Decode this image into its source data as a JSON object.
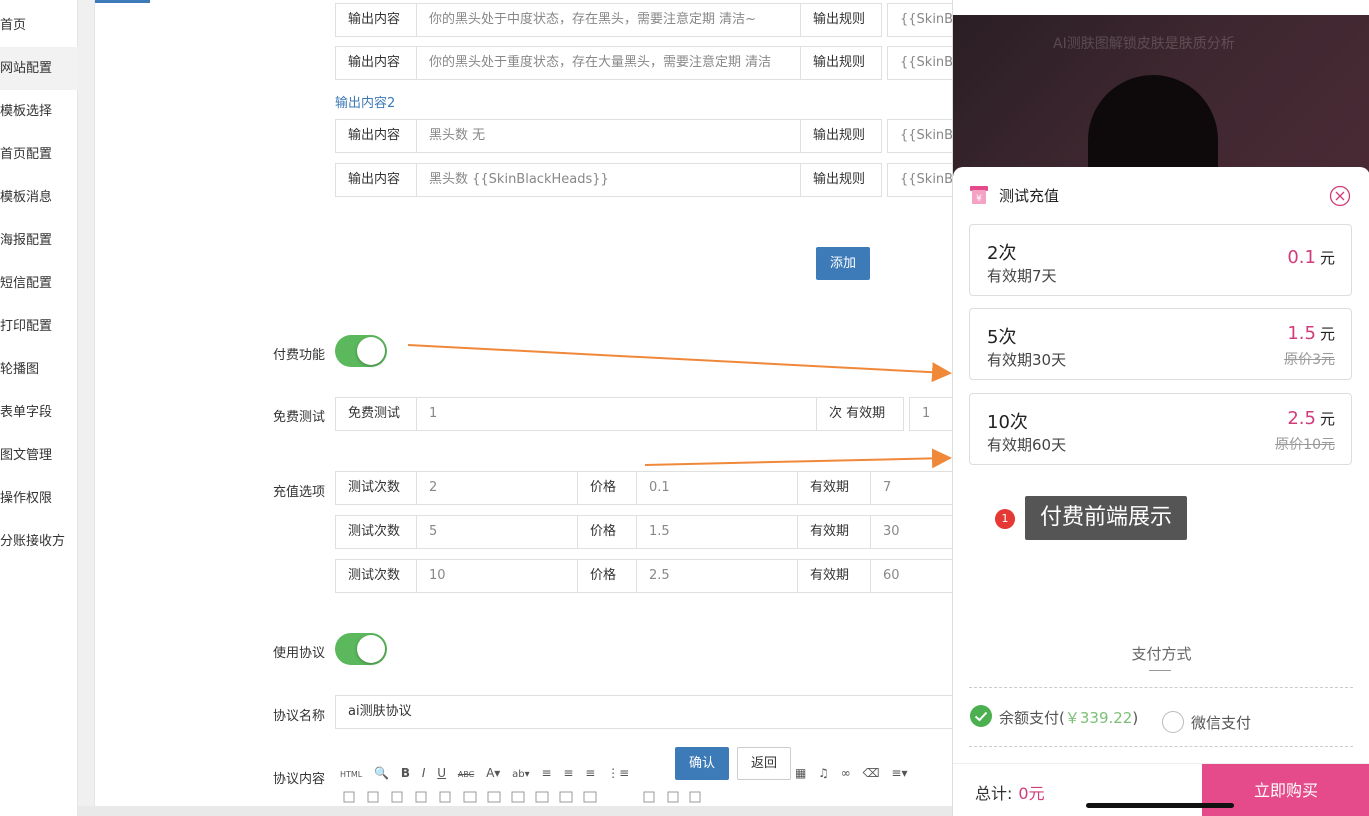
{
  "sidebar": {
    "items": [
      {
        "label": "首页"
      },
      {
        "label": "网站配置"
      },
      {
        "label": "模板选择"
      },
      {
        "label": "首页配置"
      },
      {
        "label": "模板消息"
      },
      {
        "label": "海报配置"
      },
      {
        "label": "短信配置"
      },
      {
        "label": "打印配置"
      },
      {
        "label": "轮播图"
      },
      {
        "label": "表单字段"
      },
      {
        "label": "图文管理"
      },
      {
        "label": "操作权限"
      },
      {
        "label": "分账接收方"
      }
    ]
  },
  "output_rows_top": [
    {
      "head": "输出内容",
      "value": "你的黑头处于中度状态，存在黑头，需要注意定期 清洁~",
      "rule_label": "输出规则",
      "rule": "{{SkinBla"
    },
    {
      "head": "输出内容",
      "value": "你的黑头处于重度状态，存在大量黑头，需要注意定期 清洁",
      "rule_label": "输出规则",
      "rule": "{{SkinBla"
    }
  ],
  "output2": {
    "title": "输出内容2",
    "rows": [
      {
        "head": "输出内容",
        "value": "黑头数 无",
        "rule_label": "输出规则",
        "rule": "{{SkinBla"
      },
      {
        "head": "输出内容",
        "value": "黑头数 {{SkinBlackHeads}}",
        "rule_label": "输出规则",
        "rule": "{{SkinBla"
      }
    ]
  },
  "add_button": "添加",
  "paid": {
    "label": "付费功能"
  },
  "free_test": {
    "label": "免费测试",
    "head": "免费测试",
    "value": "1",
    "unit_label": "次 有效期",
    "validity": "1"
  },
  "recharge": {
    "label": "充值选项",
    "rows": [
      {
        "count_label": "测试次数",
        "count": "2",
        "price_label": "价格",
        "price": "0.1",
        "validity_label": "有效期",
        "validity": "7"
      },
      {
        "count_label": "测试次数",
        "count": "5",
        "price_label": "价格",
        "price": "1.5",
        "validity_label": "有效期",
        "validity": "30"
      },
      {
        "count_label": "测试次数",
        "count": "10",
        "price_label": "价格",
        "price": "2.5",
        "validity_label": "有效期",
        "validity": "60"
      }
    ]
  },
  "agreement": {
    "label": "使用协议"
  },
  "agreement_name": {
    "label": "协议名称",
    "value": "ai测肤协议"
  },
  "agreement_content": {
    "label": "协议内容"
  },
  "confirm_button": "确认",
  "back_button": "返回",
  "editor_tools": [
    "HTML",
    "🔍",
    "B",
    "I",
    "U",
    "ABC",
    "A▾",
    "ab▾",
    "≡",
    "≡",
    "≡",
    "⋮≡",
    "▦",
    "♫",
    "∞",
    "⌫",
    "≡▾"
  ],
  "phone": {
    "watermark": "AI测肤图解锁皮肤是肤质分析",
    "sheet_title": "测试充值",
    "packages": [
      {
        "times": "2次",
        "valid": "有效期7天",
        "price": "0.1",
        "unit": "元",
        "orig": ""
      },
      {
        "times": "5次",
        "valid": "有效期30天",
        "price": "1.5",
        "unit": "元",
        "orig": "原价3元"
      },
      {
        "times": "10次",
        "valid": "有效期60天",
        "price": "2.5",
        "unit": "元",
        "orig": "原价10元"
      }
    ],
    "badge": "1",
    "tooltip": "付费前端展示",
    "pay_title": "支付方式",
    "balance_label": "余额支付(",
    "balance_amount": "￥339.22",
    "balance_close": ")",
    "wechat_label": "微信支付",
    "total_label": "总计:",
    "total_value": "0元",
    "buy_button": "立即购买"
  },
  "colors": {
    "accent": "#3d7ab8",
    "toggle": "#5cb85c",
    "price": "#d23c7a",
    "buy": "#e54b8a",
    "arrow": "#f0883a"
  }
}
